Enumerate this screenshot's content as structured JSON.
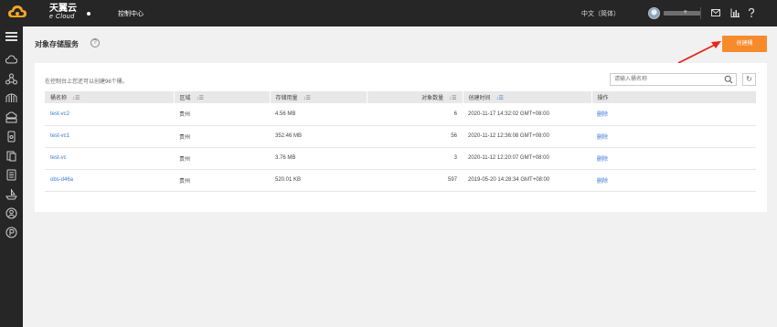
{
  "header": {
    "brand_cn": "天翼云",
    "brand_en": "e Cloud",
    "nav_console": "控制中心",
    "language": "中文（简体）",
    "user_caret": "▾",
    "icons": [
      "mail-icon",
      "chart-icon",
      "help-icon"
    ]
  },
  "sidebar": {
    "icons": [
      "cloud-icon",
      "network-icon",
      "bridge-icon",
      "cloud-storage-icon",
      "mobile-icon",
      "database-icon",
      "server-icon",
      "ship-icon",
      "badge-icon"
    ]
  },
  "page": {
    "title": "对象存储服务",
    "help": "?",
    "create_button": "创建桶"
  },
  "toolbar": {
    "hint": "在控制台上您还可以创建96个桶。",
    "search_placeholder": "请输入桶名称",
    "refresh": "↻"
  },
  "table": {
    "headers": {
      "name": "桶名称",
      "region": "区域",
      "storage": "存储用量",
      "objects": "对象数量",
      "created": "创建时间",
      "action": "操作"
    },
    "rows": [
      {
        "name": "test-vc2",
        "region": "贵州",
        "storage": "4.56 MB",
        "objects": "6",
        "created": "2020-11-17 14:32:02 GMT+08:00",
        "action": "删除"
      },
      {
        "name": "test-vc1",
        "region": "贵州",
        "storage": "352.46 MB",
        "objects": "56",
        "created": "2020-11-12 12:36:08 GMT+08:00",
        "action": "删除"
      },
      {
        "name": "test-vc",
        "region": "贵州",
        "storage": "3.76 MB",
        "objects": "3",
        "created": "2020-11-12 12:20:07 GMT+08:00",
        "action": "删除"
      },
      {
        "name": "obs-d46a",
        "region": "贵州",
        "storage": "520.01 KB",
        "objects": "597",
        "created": "2019-05-20 14:28:34 GMT+08:00",
        "action": "删除"
      }
    ]
  },
  "colors": {
    "topbar": "#262626",
    "accent_orange": "#f78b2c",
    "link_blue": "#3b78d8",
    "arrow_red": "#e8261f"
  }
}
